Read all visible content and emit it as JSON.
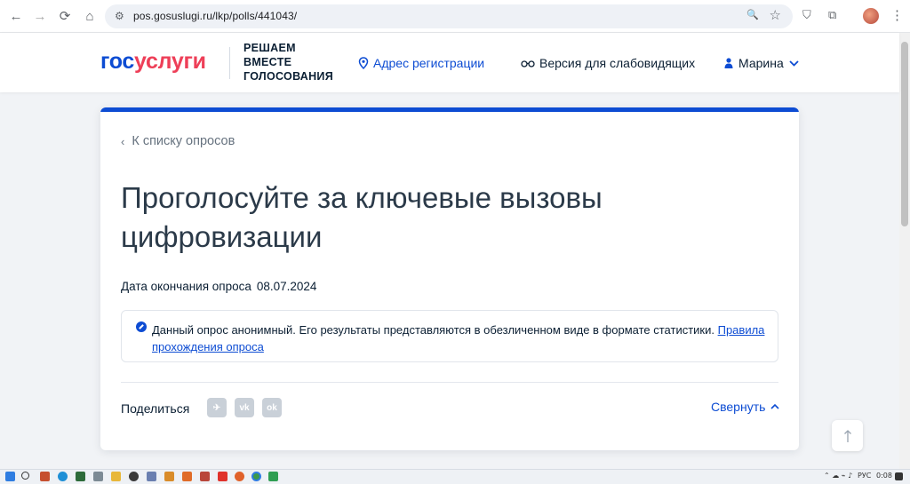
{
  "browser": {
    "url": "pos.gosuslugi.ru/lkp/polls/441043/",
    "back_glyph": "←",
    "forward_glyph": "→",
    "reload_glyph": "⟳",
    "home_glyph": "⌂",
    "tune_glyph": "⚙",
    "zoom_glyph": "🔍",
    "star_glyph": "☆",
    "shield_glyph": "⛉",
    "extensions_glyph": "⧉",
    "menu_glyph": "⋮"
  },
  "header": {
    "logo_part1": "гос",
    "logo_part2": "услуги",
    "slogan": [
      "РЕШАЕМ",
      "ВМЕСТЕ",
      "ГОЛОСОВАНИЯ"
    ],
    "address_label": "Адрес регистрации",
    "vision_label": "Версия для слабовидящих",
    "user_name": "Марина"
  },
  "poll": {
    "back_label": "К списку опросов",
    "title": "Проголосуйте за ключевые вызовы цифровизации",
    "end_date_label": "Дата окончания опроса",
    "end_date": "08.07.2024",
    "notice_text": "Данный опрос анонимный. Его результаты представляются в обезличенном виде в формате статистики. ",
    "notice_link": "Правила прохождения опроса",
    "share_label": "Поделиться",
    "share_telegram": "✈",
    "share_vk": "vk",
    "share_ok": "ok",
    "collapse_label": "Свернуть"
  },
  "taskbar": {
    "lang": "РУС",
    "time": "0:08"
  },
  "colors": {
    "brand_blue": "#0d4cd3",
    "brand_red": "#ee3f58",
    "page_bg": "#f1f3f6"
  }
}
